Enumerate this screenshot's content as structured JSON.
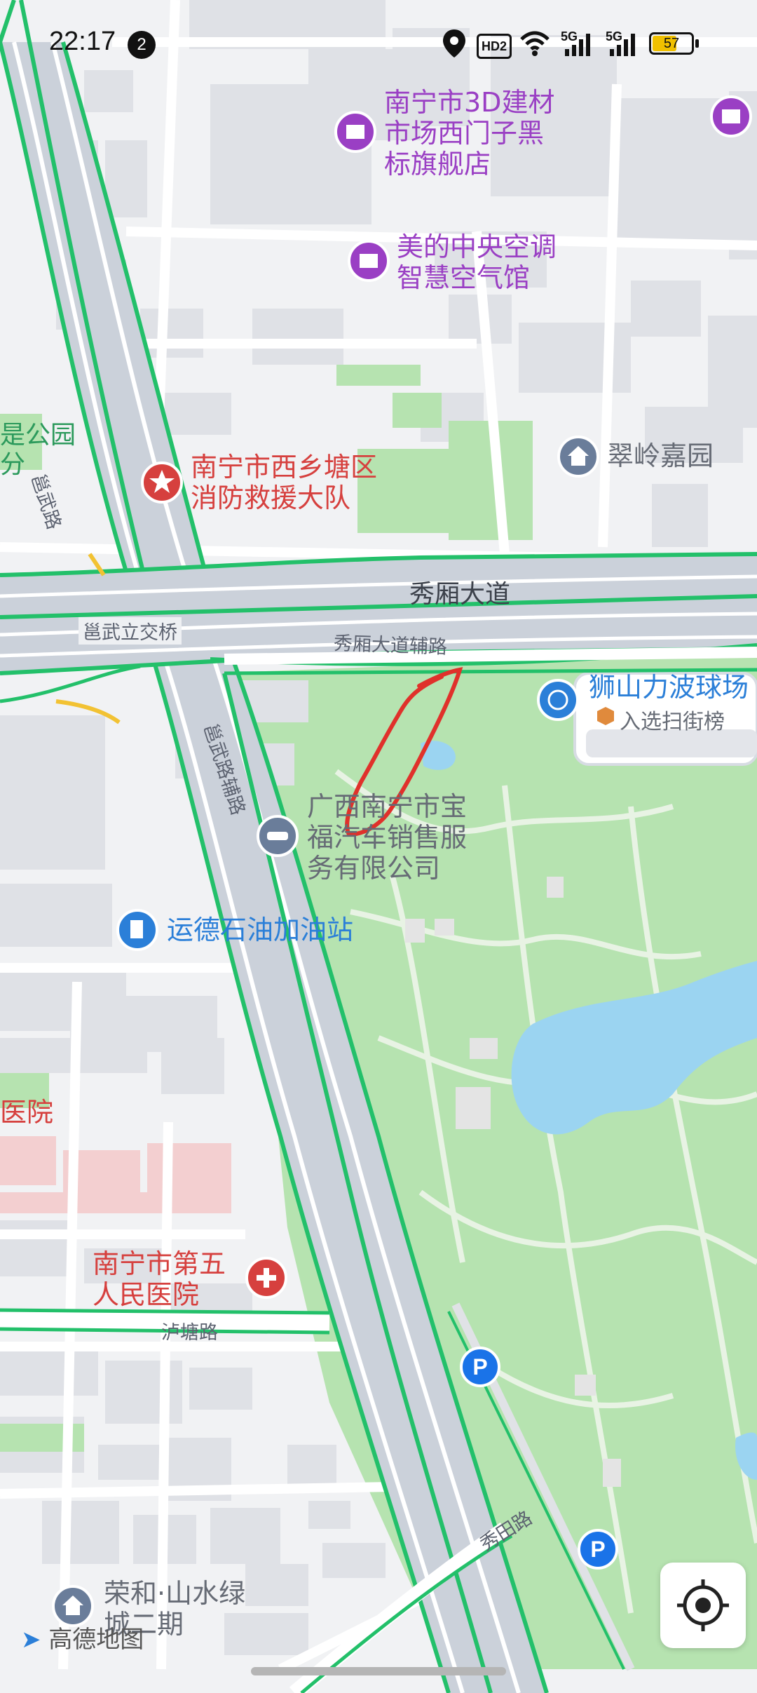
{
  "status_bar": {
    "time": "22:17",
    "notification_count": "2",
    "hd_label": "HD2",
    "signal_1": "5G",
    "signal_2": "5G",
    "battery": "57"
  },
  "pois": {
    "building_market": "南宁市3D建材\n市场西门子黑\n标旗舰店",
    "midea": "美的中央空调\n智慧空气馆",
    "fire_station": "南宁市西乡塘区\n消防救援大队",
    "cuiling": "翠岭嘉园",
    "left_park": "是公园\n分",
    "shishan": "狮山力波球场",
    "shishan_sub": "入选扫街榜",
    "baofu": "广西南宁市宝\n福汽车销售服\n务有限公司",
    "gas_station": "运德石油加油站",
    "hospital_partial": "医院",
    "hospital5": "南宁市第五\n人民医院",
    "ronghe": "荣和·山水绿\n城二期"
  },
  "roads": {
    "yongwu": "邕武路",
    "xiuxiang": "秀厢大道",
    "yongwu_bridge": "邕武立交桥",
    "xiuxiang_aux": "秀厢大道辅路",
    "yongwu_aux": "邕武路辅路",
    "lutang": "泸塘路",
    "xiutian": "秀田路"
  },
  "logo": "高德地图",
  "parking_label": "P",
  "colors": {
    "road_green": "#23c06a",
    "park_green": "#b6e3b0",
    "water": "#9bd4f1",
    "annotation_red": "#e0312b",
    "building": "#dfe1e6"
  }
}
